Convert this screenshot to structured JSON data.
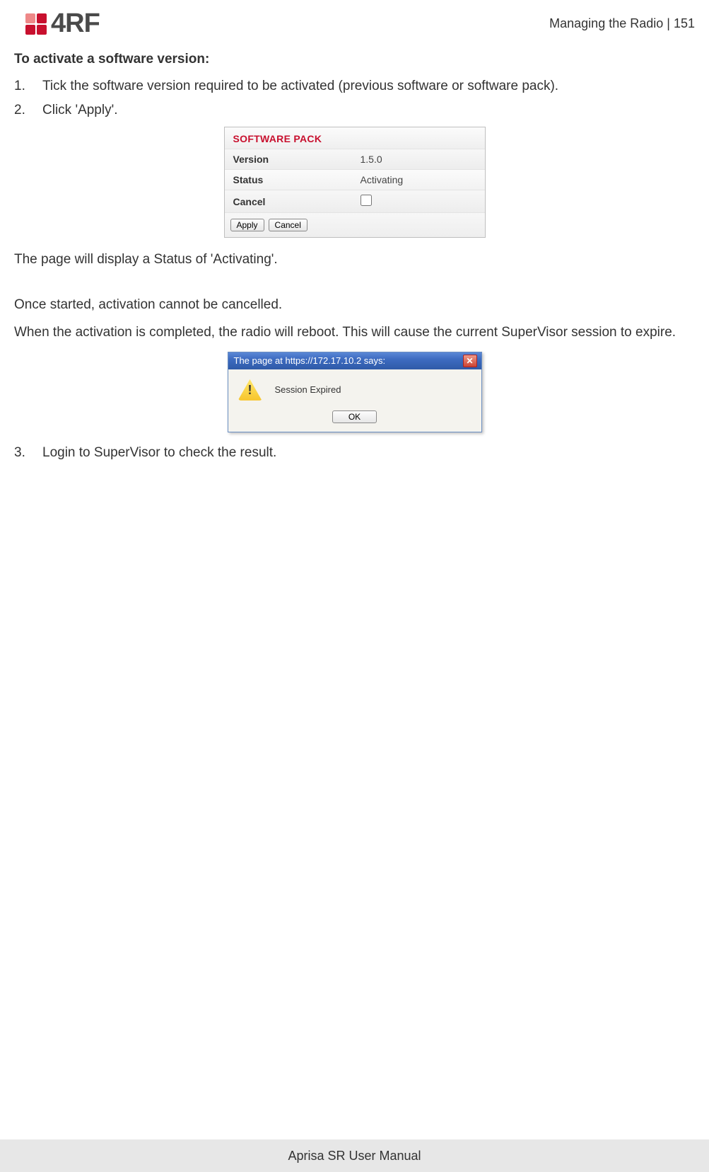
{
  "header": {
    "logo_text": "4RF",
    "section": "Managing the Radio",
    "sep": "  |  ",
    "page_no": "151"
  },
  "content": {
    "section_title": "To activate a software version:",
    "steps": [
      {
        "n": "1.",
        "text": "Tick the software version required to be activated (previous software or software pack)."
      },
      {
        "n": "2.",
        "text": "Click 'Apply'."
      },
      {
        "n": "3.",
        "text": "Login to SuperVisor to check the result."
      }
    ],
    "para_status": "The page will display a Status of 'Activating'.",
    "para_cancel": "Once started, activation cannot be cancelled.",
    "para_reboot": "When the activation is completed, the radio will reboot. This will cause the current SuperVisor session to expire."
  },
  "panel": {
    "title": "SOFTWARE PACK",
    "rows": {
      "version_k": "Version",
      "version_v": "1.5.0",
      "status_k": "Status",
      "status_v": "Activating",
      "cancel_k": "Cancel"
    },
    "buttons": {
      "apply": "Apply",
      "cancel": "Cancel"
    }
  },
  "dialog": {
    "title": "The page at https://172.17.10.2 says:",
    "message": "Session Expired",
    "ok": "OK"
  },
  "footer": "Aprisa SR User Manual"
}
